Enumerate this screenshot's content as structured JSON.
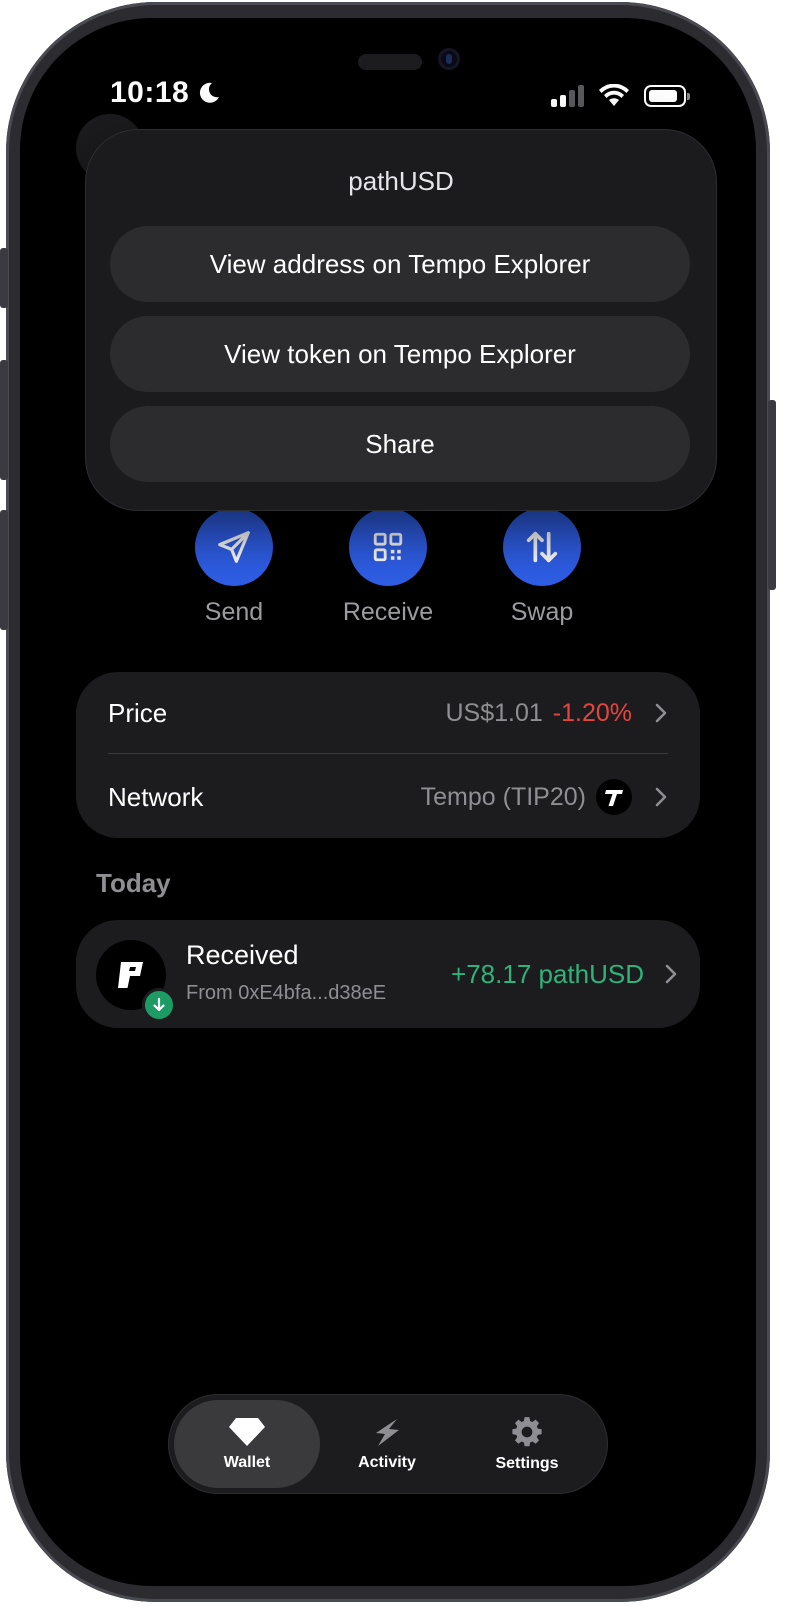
{
  "status_bar": {
    "time": "10:18"
  },
  "actions": [
    {
      "label": "Send",
      "icon": "send-icon"
    },
    {
      "label": "Receive",
      "icon": "qr-code-icon"
    },
    {
      "label": "Swap",
      "icon": "swap-arrows-icon"
    }
  ],
  "info": {
    "price_label": "Price",
    "price_value": "US$1.01",
    "price_change": "-1.20%",
    "network_label": "Network",
    "network_value": "Tempo (TIP20)"
  },
  "activity": {
    "section_title": "Today",
    "items": [
      {
        "title": "Received",
        "subtitle": "From 0xE4bfa...d38eE",
        "amount": "+78.17 pathUSD"
      }
    ]
  },
  "tabs": [
    {
      "label": "Wallet",
      "icon": "diamond-icon",
      "active": true
    },
    {
      "label": "Activity",
      "icon": "bolt-icon",
      "active": false
    },
    {
      "label": "Settings",
      "icon": "gear-icon",
      "active": false
    }
  ],
  "popover": {
    "title": "pathUSD",
    "options": [
      "View address on Tempo Explorer",
      "View token on Tempo Explorer",
      "Share"
    ]
  },
  "colors": {
    "accent": "#2f5fe8",
    "negative": "#e5453d",
    "positive": "#2fb37c",
    "background": "#000000",
    "card": "#1c1c1e"
  }
}
